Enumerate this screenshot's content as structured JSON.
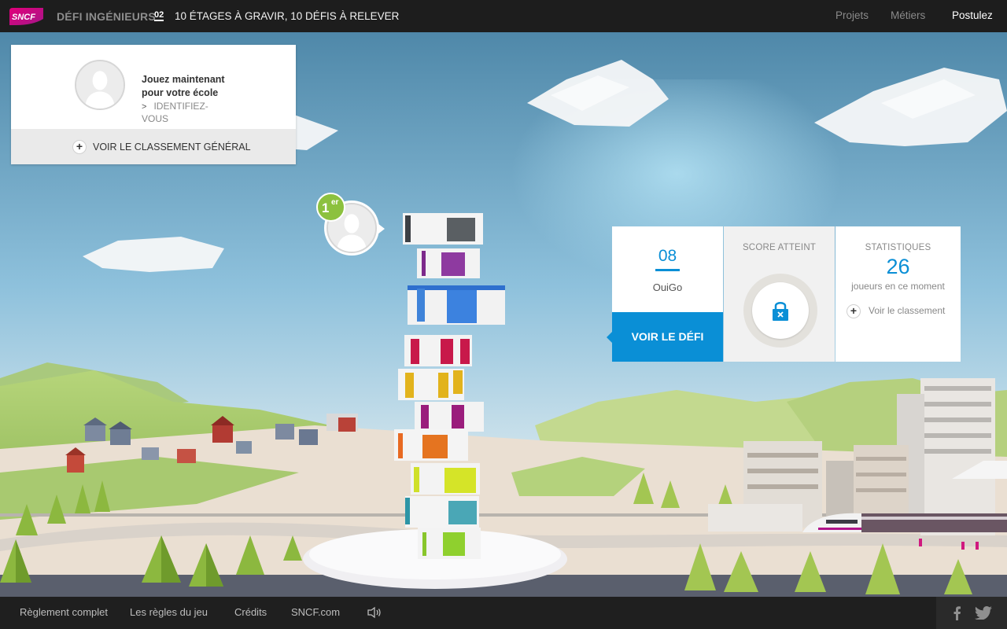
{
  "header": {
    "logo_text": "SNCF",
    "title": "DÉFI INGÉNIEURS",
    "stage_number": "02",
    "tagline": "10 ÉTAGES À GRAVIR, 10 DÉFIS À RELEVER",
    "nav": {
      "projets": "Projets",
      "metiers": "Métiers",
      "postulez": "Postulez"
    }
  },
  "login_card": {
    "title": "Jouez maintenant pour votre école",
    "identify_link": "IDENTIFIEZ-VOUS",
    "classement_button": "VOIR LE CLASSEMENT GÉNÉRAL"
  },
  "rank_badge": {
    "number": "1",
    "suffix": "er"
  },
  "challenge_panel": {
    "stage": "08",
    "stage_name": "OuiGo",
    "cta": "VOIR LE DÉFI",
    "score_title": "SCORE ATTEINT",
    "stats_title": "STATISTIQUES",
    "players_count": "26",
    "players_label": "joueurs en ce moment",
    "ranking_link": "Voir le classement"
  },
  "footer": {
    "reglement": "Règlement complet",
    "regles": "Les règles du jeu",
    "credits": "Crédits",
    "sncf": "SNCF.com"
  },
  "colors": {
    "accent_blue": "#0a8fd6",
    "rank_green": "#8cc13f",
    "topbar": "#1d1d1d",
    "brand_pink": "#c8107d"
  }
}
